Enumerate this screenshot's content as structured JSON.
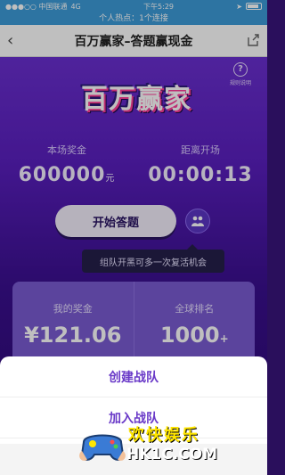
{
  "status_bar": {
    "carrier": "●●●○○ 中国联通",
    "network": "4G",
    "time": "下午5:29",
    "battery": ""
  },
  "hotspot": {
    "text": "个人热点：1个连接"
  },
  "navbar": {
    "title": "百万赢家–答题赢现金"
  },
  "game": {
    "help_label": "规则说明",
    "logo_text": "百万赢家",
    "prize_label": "本场奖金",
    "prize_value": "600000",
    "prize_unit": "元",
    "countdown_label": "距离开场",
    "countdown_value": "00:00:13",
    "start_button": "开始答题",
    "tip_text": "组队开黑可多一次复活机会",
    "my_prize_label": "我的奖金",
    "my_prize_value": "¥121.06",
    "rank_label": "全球排名",
    "rank_value": "1000",
    "rank_suffix": "+"
  },
  "action_sheet": {
    "items": [
      "创建战队",
      "加入战队"
    ]
  },
  "watermark": {
    "cn": "欢快娱乐",
    "url": "HK1C.COM"
  },
  "colors": {
    "accent": "#6a3ac8",
    "status_bar": "#3c9bd8",
    "game_bg": "#5a1fbf"
  }
}
